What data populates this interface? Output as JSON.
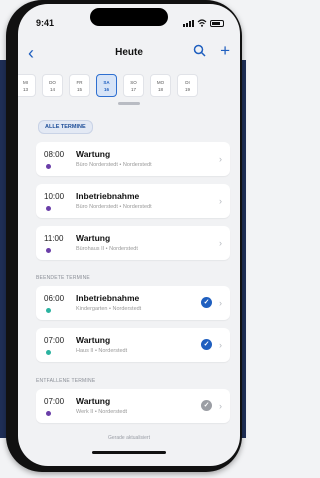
{
  "status": {
    "time": "9:41"
  },
  "nav": {
    "title": "Heute",
    "back_icon": "chevron-left-icon",
    "search_icon": "search-icon",
    "add_icon": "plus-icon"
  },
  "days": [
    {
      "wd": "MI",
      "d": "13"
    },
    {
      "wd": "DO",
      "d": "14"
    },
    {
      "wd": "FR",
      "d": "15"
    },
    {
      "wd": "SA",
      "d": "16"
    },
    {
      "wd": "SO",
      "d": "17"
    },
    {
      "wd": "MO",
      "d": "18"
    },
    {
      "wd": "DI",
      "d": "19"
    }
  ],
  "filter": {
    "label": "ALLE TERMINE"
  },
  "upcoming": [
    {
      "time": "08:00",
      "title": "Wartung",
      "sub": "Büro Norderstedt • Norderstedt",
      "dot": "#6a3ea8"
    },
    {
      "time": "10:00",
      "title": "Inbetriebnahme",
      "sub": "Büro Norderstedt • Norderstedt",
      "dot": "#6a3ea8"
    },
    {
      "time": "11:00",
      "title": "Wartung",
      "sub": "Bürohaus II • Norderstedt",
      "dot": "#6a3ea8"
    }
  ],
  "done_label": "BEENDETE TERMINE",
  "done": [
    {
      "time": "06:00",
      "title": "Inbetriebnahme",
      "sub": "Kindergarten • Norderstedt",
      "dot": "#2bb3a0"
    },
    {
      "time": "07:00",
      "title": "Wartung",
      "sub": "Haus II • Norderstedt",
      "dot": "#2bb3a0"
    }
  ],
  "cancelled_label": "ENTFALLENE TERMINE",
  "cancelled": [
    {
      "time": "07:00",
      "title": "Wartung",
      "sub": "Werk II • Norderstedt",
      "dot": "#6a3ea8"
    }
  ],
  "footer": "Gerade aktualisiert",
  "colors": {
    "accent": "#1f5fbf",
    "navy": "#1f2f57",
    "check_done": "#1f5fbf",
    "check_cancelled": "#9b9ea4"
  }
}
